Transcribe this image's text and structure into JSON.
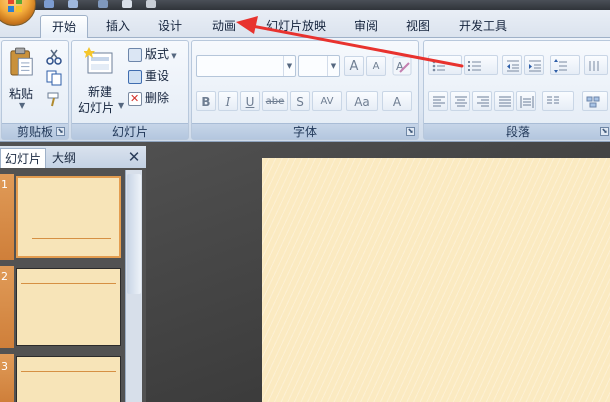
{
  "tabs": [
    {
      "label": "开始",
      "active": true
    },
    {
      "label": "插入",
      "active": false
    },
    {
      "label": "设计",
      "active": false
    },
    {
      "label": "动画",
      "active": false
    },
    {
      "label": "幻灯片放映",
      "active": false
    },
    {
      "label": "审阅",
      "active": false
    },
    {
      "label": "视图",
      "active": false
    },
    {
      "label": "开发工具",
      "active": false
    }
  ],
  "clipboard": {
    "paste_label": "粘贴",
    "group_label": "剪贴板"
  },
  "slides_group": {
    "new_slide_line1": "新建",
    "new_slide_line2": "幻灯片",
    "layout_label": "版式",
    "reset_label": "重设",
    "delete_label": "删除",
    "group_label": "幻灯片"
  },
  "font_group": {
    "bold_label": "B",
    "italic_label": "I",
    "underline_label": "U",
    "strike_label": "abe",
    "shadow_label": "S",
    "spacing_label": "AV",
    "case_label": "Aa",
    "color_label": "A",
    "grow_label": "A",
    "shrink_label": "A",
    "group_label": "字体"
  },
  "paragraph_group": {
    "group_label": "段落"
  },
  "panel": {
    "tab_slides": "幻灯片",
    "tab_outline": "大纲",
    "close_glyph": "✕",
    "slide_numbers": [
      "1",
      "2",
      "3"
    ]
  },
  "colors": {
    "accent_arrow": "#e8322e",
    "slide_background": "#fbeac1",
    "thumbnail_accent": "#e09b58"
  }
}
